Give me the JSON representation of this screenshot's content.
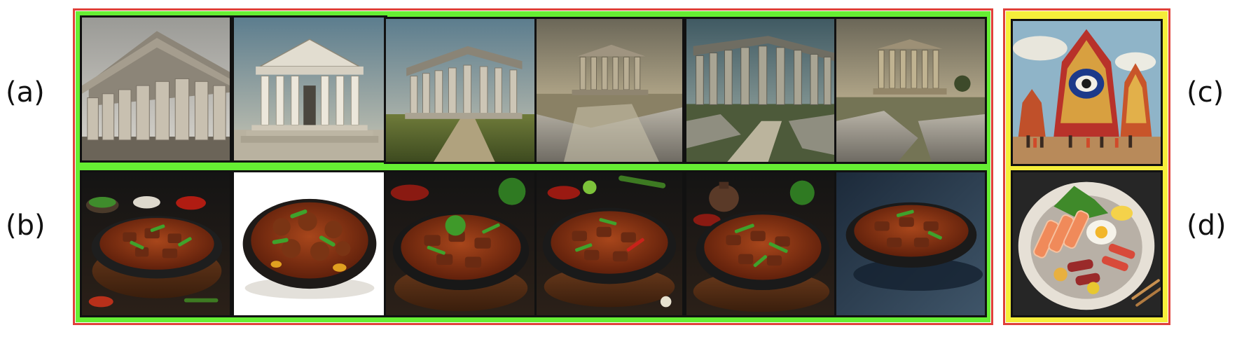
{
  "labels": {
    "a": "(a)",
    "b": "(b)",
    "c": "(c)",
    "d": "(d)"
  },
  "colors": {
    "outer_border": "#e0403a",
    "left_group_fill": "#66ee33",
    "right_group_fill": "#f5ee3a",
    "tile_border": "#111111"
  },
  "rows": {
    "a": {
      "subject": "greek-temple",
      "count": 6
    },
    "b": {
      "subject": "curry-in-pan",
      "count": 6
    },
    "c": {
      "subject": "indian-temple",
      "count": 1
    },
    "d": {
      "subject": "sashimi-bowl",
      "count": 1
    }
  }
}
